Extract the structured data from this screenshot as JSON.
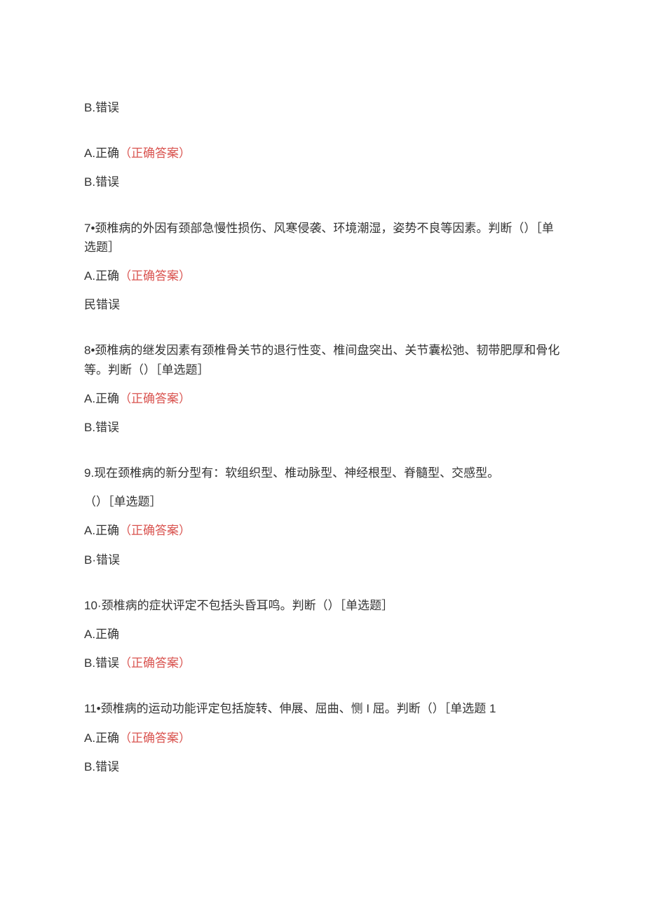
{
  "blocks": [
    {
      "lines": [
        {
          "prefix": "B.",
          "text": "错误",
          "answer": false
        }
      ]
    },
    {
      "lines": [
        {
          "prefix": "A.",
          "text": "正确",
          "answer": true,
          "answerText": "（正确答案）"
        },
        {
          "prefix": "B.",
          "text": "错误",
          "answer": false
        }
      ]
    },
    {
      "lines": [
        {
          "prefix": "7•",
          "text": "颈椎病的外因有颈部急慢性损伤、风寒侵袭、环境潮湿，姿势不良等因素。判断（）［单选题］",
          "answer": false
        },
        {
          "prefix": "A.",
          "text": "正确",
          "answer": true,
          "answerText": "（正确答案）"
        },
        {
          "prefix": "民",
          "text": "错误",
          "answer": false
        }
      ]
    },
    {
      "lines": [
        {
          "prefix": "8•",
          "text": "颈椎病的继发因素有颈椎骨关节的退行性变、椎间盘突出、关节囊松弛、韧带肥厚和骨化等。判断（）［单选题］",
          "answer": false
        },
        {
          "prefix": "A.",
          "text": "正确",
          "answer": true,
          "answerText": "（正确答案）"
        },
        {
          "prefix": "B.",
          "text": "错误",
          "answer": false
        }
      ]
    },
    {
      "lines": [
        {
          "prefix": "9.",
          "text": "现在颈椎病的新分型有：软组织型、椎动脉型、神经根型、脊髓型、交感型。",
          "answer": false
        },
        {
          "prefix": "",
          "text": "（）［单选题］",
          "answer": false
        },
        {
          "prefix": "A.",
          "text": "正确",
          "answer": true,
          "answerText": "（正确答案）"
        },
        {
          "prefix": "B·",
          "text": "错误",
          "answer": false
        }
      ]
    },
    {
      "lines": [
        {
          "prefix": "10·",
          "text": "颈椎病的症状评定不包括头昏耳鸣。判断（）［单选题］",
          "answer": false
        },
        {
          "prefix": "A.",
          "text": "正确",
          "answer": false
        },
        {
          "prefix": "B.",
          "text": "错误",
          "answer": true,
          "answerText": "（正确答案）"
        }
      ]
    },
    {
      "lines": [
        {
          "prefix": "11•",
          "text": "颈椎病的运动功能评定包括旋转、伸展、屈曲、恻 I 屈。判断（）［单选题 1",
          "answer": false
        },
        {
          "prefix": "A.",
          "text": "正确",
          "answer": true,
          "answerText": "（正确答案）"
        },
        {
          "prefix": "B.",
          "text": "错误",
          "answer": false
        }
      ]
    }
  ]
}
